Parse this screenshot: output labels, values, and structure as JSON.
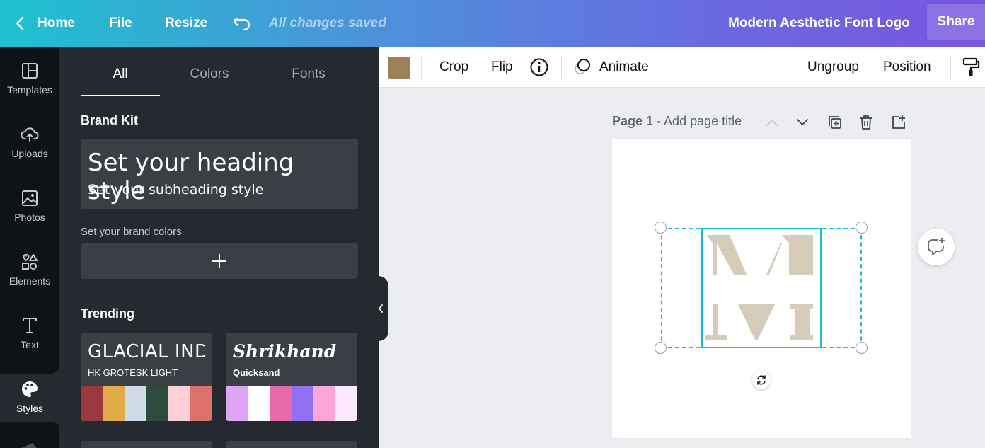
{
  "topbar": {
    "home_label": "Home",
    "file_label": "File",
    "resize_label": "Resize",
    "save_status": "All changes saved",
    "design_title": "Modern Aesthetic Font Logo",
    "share_label": "Share",
    "gradient_colors": [
      "#1ec2cf",
      "#7a55e0"
    ]
  },
  "rail": {
    "items": [
      {
        "label": "Templates",
        "icon": "templates-icon"
      },
      {
        "label": "Uploads",
        "icon": "upload-cloud-icon"
      },
      {
        "label": "Photos",
        "icon": "photo-icon"
      },
      {
        "label": "Elements",
        "icon": "shapes-icon"
      },
      {
        "label": "Text",
        "icon": "text-icon"
      },
      {
        "label": "Styles",
        "icon": "palette-icon"
      }
    ],
    "active": "Styles"
  },
  "panel": {
    "tabs": [
      "All",
      "Colors",
      "Fonts"
    ],
    "active_tab": "All",
    "brand_kit_title": "Brand Kit",
    "heading_style": "Set your heading style",
    "subheading_style": "Set your subheading style",
    "brand_colors_label": "Set your brand colors",
    "trending_title": "Trending",
    "trending": [
      {
        "heading": "GLACIAL INDIFFERENCE",
        "sub": "HK GROTESK LIGHT",
        "colors": [
          "#9b3a3e",
          "#e0aa44",
          "#cfdbe6",
          "#2d4b3f",
          "#fdd0d8",
          "#dd726d"
        ]
      },
      {
        "heading": "Shrikhand",
        "sub": "Quicksand",
        "colors": [
          "#e0a4f5",
          "#ffffff",
          "#e86aa9",
          "#8f72f1",
          "#fca6d8",
          "#fbeafd"
        ]
      }
    ]
  },
  "toolbar": {
    "color_chip": "#9b8058",
    "crop_label": "Crop",
    "flip_label": "Flip",
    "animate_label": "Animate",
    "ungroup_label": "Ungroup",
    "position_label": "Position"
  },
  "canvas": {
    "page_number": "Page 1 -",
    "page_title_placeholder": "Add page title",
    "logo_color": "#d5ccba",
    "selection_color": "#18bccf"
  }
}
